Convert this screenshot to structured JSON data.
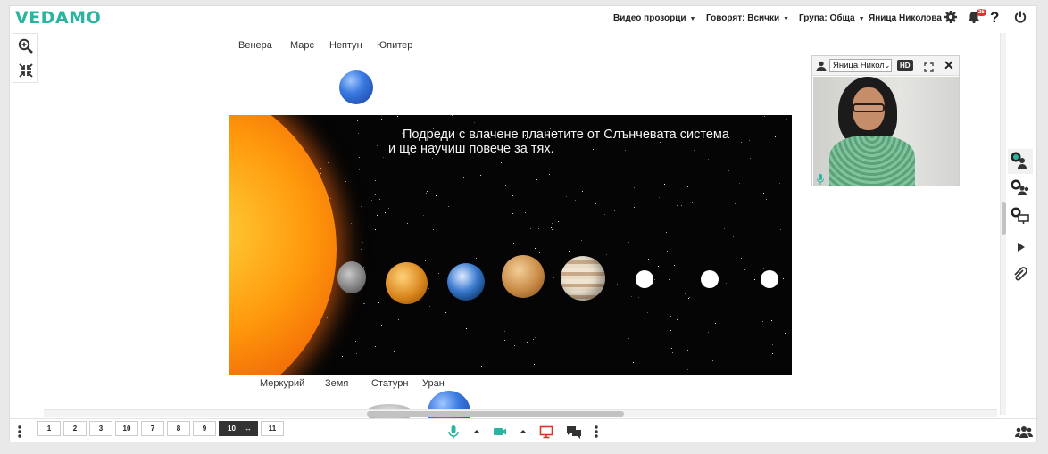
{
  "app": {
    "logo": "VEDAMO"
  },
  "topbar": {
    "video_windows": "Видео прозорци",
    "speaking": "Говорят: Всички",
    "group": "Група: Обща",
    "user": "Яница Николова",
    "notifications_count": "25"
  },
  "board": {
    "top_labels": [
      "Венера",
      "Марс",
      "Нептун",
      "Юпитер"
    ],
    "bottom_labels": [
      "Меркурий",
      "Земя",
      "Статурн",
      "Уран"
    ],
    "slide_text": [
      "Подреди с влачене планетите от Слънчевата система",
      "и ще научиш повече за тях."
    ]
  },
  "video": {
    "name": "Яница Николова",
    "quality": "HD"
  },
  "pages": {
    "tabs": [
      "1",
      "2",
      "3",
      "10",
      "7",
      "8",
      "9",
      "10",
      "11"
    ],
    "active_index": 7
  },
  "icons": {
    "zoom": "zoom-in-icon",
    "fit": "fit-screen-icon",
    "settings": "gear-icon",
    "bell": "bell-icon",
    "help": "help-icon",
    "power": "power-icon",
    "mic": "microphone-icon",
    "camera": "camera-icon",
    "screen": "screen-share-icon",
    "chat": "chat-icon",
    "more": "more-vertical-icon",
    "users": "users-icon"
  },
  "colors": {
    "brand": "#2bb5a0",
    "badge": "#d9352b",
    "screen_share": "#d9352b",
    "media_on": "#2bb5a0"
  }
}
